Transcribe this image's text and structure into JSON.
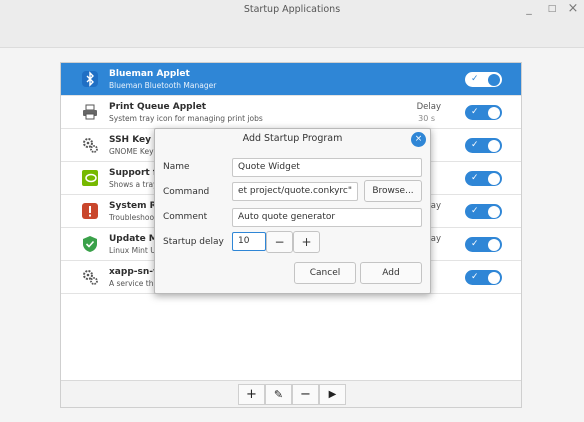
{
  "window": {
    "title": "Startup Applications",
    "minimize": "_",
    "maximize": "□",
    "close": "×"
  },
  "list": [
    {
      "name": "Blueman Applet",
      "desc": "Blueman Bluetooth Manager",
      "delay_label": "",
      "delay": "",
      "icon": "bluetooth-icon",
      "enabled": true,
      "selected": true
    },
    {
      "name": "Print Queue Applet",
      "desc": "System tray icon for managing print jobs",
      "delay_label": "Delay",
      "delay": "30 s",
      "icon": "printer-icon",
      "enabled": true,
      "selected": false
    },
    {
      "name": "SSH Key A",
      "desc": "GNOME Key",
      "delay_label": "",
      "delay": "",
      "icon": "gears-icon",
      "enabled": true,
      "selected": false
    },
    {
      "name": "Support f",
      "desc": "Shows a tray",
      "delay_label": "",
      "delay": "",
      "icon": "nvidia-icon",
      "enabled": true,
      "selected": false
    },
    {
      "name": "System Re",
      "desc": "Troubleshoo",
      "delay_label": "ay",
      "delay": "",
      "icon": "report-icon",
      "enabled": true,
      "selected": false
    },
    {
      "name": "Update M",
      "desc": "Linux Mint U",
      "delay_label": "ay",
      "delay": "",
      "icon": "shield-icon",
      "enabled": true,
      "selected": false
    },
    {
      "name": "xapp-sn-w",
      "desc": "A service tha",
      "delay_label": "",
      "delay": "",
      "icon": "gears-icon",
      "enabled": true,
      "selected": false
    }
  ],
  "toolbar": {
    "add": "+",
    "edit": "✎",
    "remove": "−",
    "run": "▶"
  },
  "dialog": {
    "title": "Add Startup Program",
    "close": "×",
    "name_label": "Name",
    "name_value": "Quote Widget",
    "command_label": "Command",
    "command_value": "et project/quote.conkyrc\"",
    "browse": "Browse...",
    "comment_label": "Comment",
    "comment_value": "Auto quote generator",
    "delay_label": "Startup delay",
    "delay_value": "10",
    "minus": "−",
    "plus": "+",
    "cancel": "Cancel",
    "add": "Add"
  },
  "colors": {
    "accent": "#2f86d6"
  }
}
